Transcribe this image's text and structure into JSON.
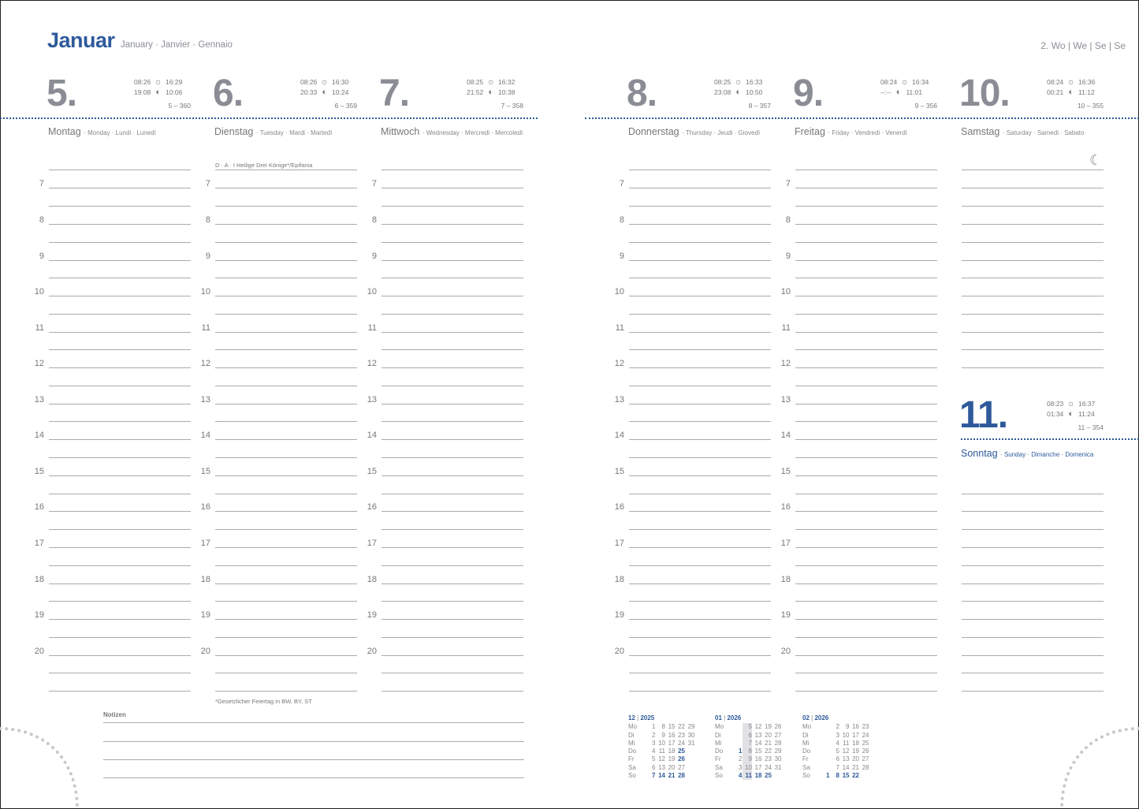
{
  "header": {
    "month": "Januar",
    "month_translations": "January · Janvier · Gennaio",
    "week": "2. Wo | We | Se | Se"
  },
  "days": [
    {
      "num": "5.",
      "sunrise": "08:26",
      "sunset": "16:29",
      "moonrise": "19:08",
      "moonset": "10:06",
      "index": "5 – 360",
      "name": "Montag",
      "translations": "· Monday · Lundi · Lunedì",
      "moon_icon": "half-moon-icon"
    },
    {
      "num": "6.",
      "sunrise": "08:26",
      "sunset": "16:30",
      "moonrise": "20:33",
      "moonset": "10:24",
      "index": "6 – 359",
      "name": "Dienstag",
      "translations": "· Tuesday · Mardi · Martedì",
      "holiday": "D · A · I    Heilige Drei Könige*/Epifania",
      "footnote": "*Gesetzlicher Feiertag in BW, BY, ST"
    },
    {
      "num": "7.",
      "sunrise": "08:25",
      "sunset": "16:32",
      "moonrise": "21:52",
      "moonset": "10:38",
      "index": "7 – 358",
      "name": "Mittwoch",
      "translations": "· Wednesday · Mercredi · Mercoledì"
    },
    {
      "num": "8.",
      "sunrise": "08:25",
      "sunset": "16:33",
      "moonrise": "23:08",
      "moonset": "10:50",
      "index": "8 – 357",
      "name": "Donnerstag",
      "translations": "· Thursday · Jeudi · Giovedì"
    },
    {
      "num": "9.",
      "sunrise": "08:24",
      "sunset": "16:34",
      "moonrise": "--:--",
      "moonset": "11:01",
      "index": "9 – 356",
      "name": "Freitag",
      "translations": "· Friday · Vendredi · Venerdì"
    },
    {
      "num": "10.",
      "sunrise": "08:24",
      "sunset": "16:36",
      "moonrise": "00:21",
      "moonset": "11:12",
      "index": "10 – 355",
      "name": "Samstag",
      "translations": "· Saturday · Samedi · Sabato"
    },
    {
      "num": "11.",
      "sunrise": "08:23",
      "sunset": "16:37",
      "moonrise": "01:34",
      "moonset": "11:24",
      "index": "11 – 354",
      "name": "Sonntag",
      "translations": "· Sunday · Dimanche · Domenica"
    }
  ],
  "hours": [
    "7",
    "8",
    "9",
    "10",
    "11",
    "12",
    "13",
    "14",
    "15",
    "16",
    "17",
    "18",
    "19",
    "20"
  ],
  "notes": {
    "label": "Notizen"
  },
  "minicals": [
    {
      "month": "12",
      "year": "2025",
      "rows": [
        {
          "l": "Mo",
          "d": [
            "1",
            "8",
            "15",
            "22",
            "29"
          ]
        },
        {
          "l": "Di",
          "d": [
            "2",
            "9",
            "16",
            "23",
            "30"
          ]
        },
        {
          "l": "Mi",
          "d": [
            "3",
            "10",
            "17",
            "24",
            "31"
          ]
        },
        {
          "l": "Do",
          "d": [
            "4",
            "11",
            "18",
            "25",
            ""
          ]
        },
        {
          "l": "Fr",
          "d": [
            "5",
            "12",
            "19",
            "26",
            ""
          ]
        },
        {
          "l": "Sa",
          "d": [
            "6",
            "13",
            "20",
            "27",
            ""
          ]
        },
        {
          "l": "So",
          "d": [
            "7",
            "14",
            "21",
            "28",
            ""
          ]
        }
      ]
    },
    {
      "month": "01",
      "year": "2026",
      "rows": [
        {
          "l": "Mo",
          "d": [
            "",
            "5",
            "12",
            "19",
            "26"
          ]
        },
        {
          "l": "Di",
          "d": [
            "",
            "6",
            "13",
            "20",
            "27"
          ]
        },
        {
          "l": "Mi",
          "d": [
            "",
            "7",
            "14",
            "21",
            "28"
          ]
        },
        {
          "l": "Do",
          "d": [
            "1",
            "8",
            "15",
            "22",
            "29"
          ]
        },
        {
          "l": "Fr",
          "d": [
            "2",
            "9",
            "16",
            "23",
            "30"
          ]
        },
        {
          "l": "Sa",
          "d": [
            "3",
            "10",
            "17",
            "24",
            "31"
          ]
        },
        {
          "l": "So",
          "d": [
            "4",
            "11",
            "18",
            "25",
            ""
          ]
        }
      ]
    },
    {
      "month": "02",
      "year": "2026",
      "rows": [
        {
          "l": "Mo",
          "d": [
            "",
            "2",
            "9",
            "16",
            "23"
          ]
        },
        {
          "l": "Di",
          "d": [
            "",
            "3",
            "10",
            "17",
            "24"
          ]
        },
        {
          "l": "Mi",
          "d": [
            "",
            "4",
            "11",
            "18",
            "25"
          ]
        },
        {
          "l": "Do",
          "d": [
            "",
            "5",
            "12",
            "19",
            "26"
          ]
        },
        {
          "l": "Fr",
          "d": [
            "",
            "6",
            "13",
            "20",
            "27"
          ]
        },
        {
          "l": "Sa",
          "d": [
            "",
            "7",
            "14",
            "21",
            "28"
          ]
        },
        {
          "l": "So",
          "d": [
            "1",
            "8",
            "15",
            "22",
            ""
          ]
        }
      ]
    }
  ],
  "colors": {
    "accent": "#2e5a9a",
    "text": "#868a93",
    "rule": "#a9abb1"
  }
}
